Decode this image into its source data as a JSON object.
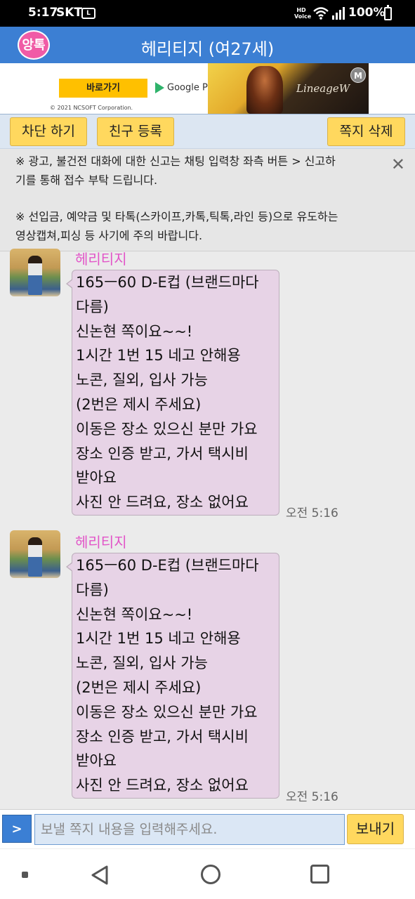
{
  "status_bar": {
    "time": "5:17",
    "carrier": "SKT",
    "sim_label": "L",
    "hd_voice": "HD\nVoice",
    "battery": "100%"
  },
  "header": {
    "logo_text": "앙톡",
    "title": "헤리티지 (여27세)"
  },
  "ad": {
    "button": "바로가기",
    "store": "Google Play",
    "copyright": "© 2021 NCSOFT Corporation.",
    "brand": "LineageW",
    "badge": "M"
  },
  "actions": {
    "block": "차단 하기",
    "add_friend": "친구 등록",
    "delete": "쪽지 삭제"
  },
  "notice": {
    "line1": "※ 광고, 불건전 대화에 대한 신고는 채팅 입력창 좌측 버튼 > 신고하기를 통해 접수 부탁 드립니다.",
    "line2": "※ 선입금, 예약금 및 타톡(스카이프,카톡,틱톡,라인 등)으로 유도하는 영상캡쳐,피싱 등 사기에 주의 바랍니다."
  },
  "messages": [
    {
      "sender": "헤리티지",
      "lines": [
        "165ㅡ60 D-E컵 (브랜드마다",
        "다름)",
        "신논현 쪽이요~~!",
        "1시간 1번 15 네고 안해용",
        "노콘, 질외, 입사 가능",
        "(2번은 제시 주세요)",
        "이동은 장소 있으신 분만 가요",
        "장소 인증 받고, 가서 택시비",
        "받아요",
        "사진 안 드려요, 장소 없어요"
      ],
      "time": "오전 5:16"
    },
    {
      "sender": "헤리티지",
      "lines": [
        "165ㅡ60 D-E컵 (브랜드마다",
        "다름)",
        "신논현 쪽이요~~!",
        "1시간 1번 15 네고 안해용",
        "노콘, 질외, 입사 가능",
        "(2번은 제시 주세요)",
        "이동은 장소 있으신 분만 가요",
        "장소 인증 받고, 가서 택시비",
        "받아요",
        "사진 안 드려요, 장소 없어요"
      ],
      "time": "오전 5:16"
    }
  ],
  "input": {
    "expand_label": ">",
    "placeholder": "보낼 쪽지 내용을 입력해주세요.",
    "send": "보내기"
  },
  "colors": {
    "header": "#3c7fd3",
    "logo": "#f05ba6",
    "button": "#ffd85e",
    "bubble": "#e7d3e6",
    "sender": "#e255c8"
  }
}
